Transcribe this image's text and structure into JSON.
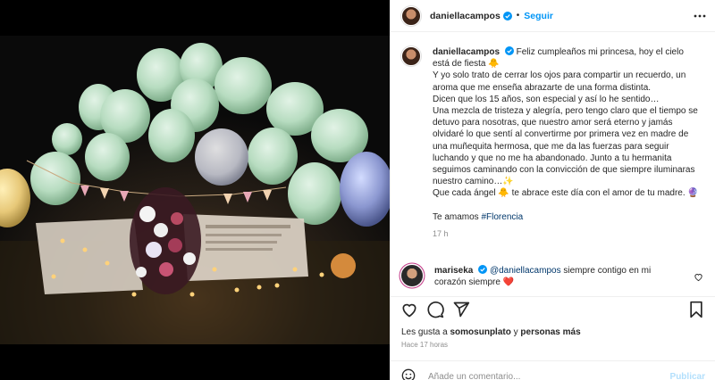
{
  "post": {
    "username": "daniellacampos",
    "follow_label": "Seguir",
    "separator": "•",
    "caption": {
      "username": "daniellacampos",
      "lines": [
        "Feliz cumpleaños mi princesa, hoy el cielo está de fiesta 🐥",
        "Y yo solo trato de cerrar los ojos para compartir un recuerdo, un aroma que me enseña abrazarte de una forma distinta.",
        "Dicen que los 15 años, son especial y así lo he sentido…",
        "Una mezcla de tristeza y alegría, pero tengo claro que el tiempo se detuvo para nosotras, que nuestro amor será eterno y jamás olvidaré lo que sentí al convertirme por primera vez en madre de una muñequita hermosa, que me da las fuerzas para seguir luchando y que no me ha abandonado. Junto a tu hermanita seguimos caminando con la convicción de que siempre iluminaras nuestro camino…✨",
        "Que cada ángel 🐥 te abrace este día con el amor de tu madre. 🔮"
      ],
      "closing": "Te amamos",
      "hashtag": "#Florencia",
      "time": "17 h"
    },
    "comment": {
      "username": "mariseka",
      "mention": "@daniellacampos",
      "text": "siempre contigo en mi corazón siempre ❤️"
    },
    "likes": {
      "prefix": "Les gusta a",
      "user": "somosunplato",
      "connector": "y",
      "others": "personas más"
    },
    "posted_ago": "Hace 17 horas",
    "add_comment": {
      "placeholder": "Añade un comentario...",
      "publish_label": "Publicar"
    }
  },
  "colors": {
    "link_blue": "#0095f6",
    "hashtag": "#00376b",
    "muted": "#8e8e8e",
    "publish_disabled": "#b2dffc"
  },
  "icons": [
    "verified-badge-icon",
    "more-options-icon",
    "heart-icon",
    "comment-icon",
    "share-icon",
    "bookmark-icon",
    "emoji-icon"
  ]
}
